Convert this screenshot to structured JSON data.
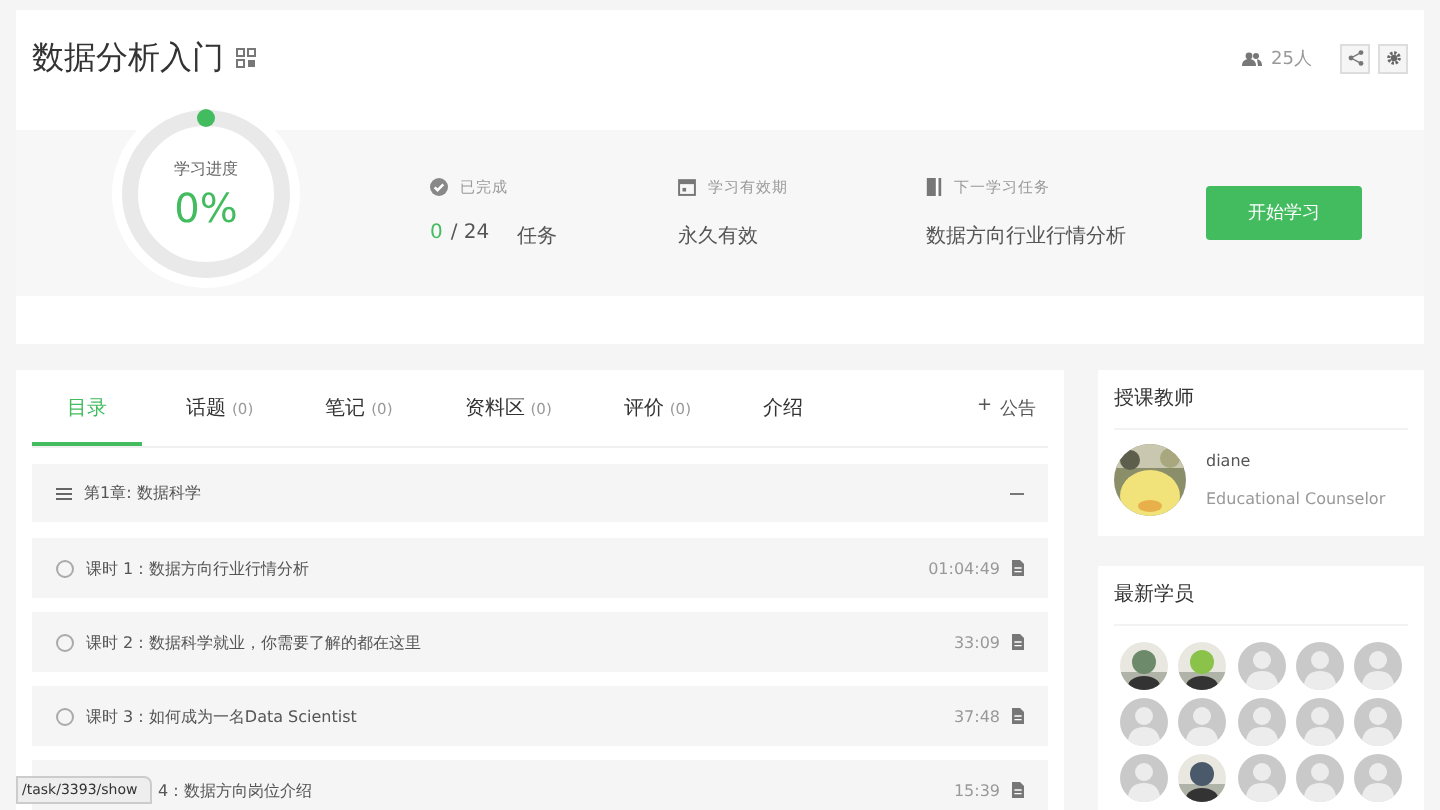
{
  "course": {
    "title": "数据分析入门",
    "members": "25人"
  },
  "progress": {
    "label": "学习进度",
    "percent": "0%"
  },
  "stats": [
    {
      "kind": "done",
      "label": "已完成",
      "done": "0",
      "total": "/ 24",
      "unit": "任务"
    },
    {
      "kind": "period",
      "label": "学习有效期",
      "value": "永久有效"
    },
    {
      "kind": "next",
      "label": "下一学习任务",
      "value": "数据方向行业行情分析"
    }
  ],
  "start_button": "开始学习",
  "tabs": [
    {
      "label": "目录",
      "selected": true
    },
    {
      "label": "话题",
      "count": "(0)",
      "selected": false
    },
    {
      "label": "笔记",
      "count": "(0)",
      "selected": false
    },
    {
      "label": "资料区",
      "count": "(0)",
      "selected": false
    },
    {
      "label": "评价",
      "count": "(0)",
      "selected": false
    },
    {
      "label": "介绍",
      "selected": false
    }
  ],
  "announce": {
    "icon": "+",
    "label": "公告"
  },
  "chapter": {
    "title": "第1章: 数据科学",
    "expanded": true,
    "lessons": [
      {
        "title": "课时 1 : 数据方向行业行情分析",
        "duration": "01:04:49"
      },
      {
        "title": "课时 2 : 数据科学就业，你需要了解的都在这里",
        "duration": "33:09"
      },
      {
        "title": "课时 3 : 如何成为一名Data Scientist",
        "duration": "37:48"
      },
      {
        "title": "4 : 数据方向岗位介绍",
        "duration": "15:39"
      }
    ]
  },
  "status_url": "/task/3393/show",
  "teacher": {
    "heading": "授课教师",
    "name": "diane",
    "role": "Educational Counselor"
  },
  "students": {
    "heading": "最新学员",
    "avatars": [
      {
        "kind": "picture"
      },
      {
        "kind": "picture"
      },
      {
        "kind": "default"
      },
      {
        "kind": "default"
      },
      {
        "kind": "default"
      },
      {
        "kind": "default"
      },
      {
        "kind": "default"
      },
      {
        "kind": "default"
      },
      {
        "kind": "default"
      },
      {
        "kind": "default"
      },
      {
        "kind": "default"
      },
      {
        "kind": "picture"
      },
      {
        "kind": "default"
      },
      {
        "kind": "default"
      },
      {
        "kind": "default"
      }
    ]
  }
}
